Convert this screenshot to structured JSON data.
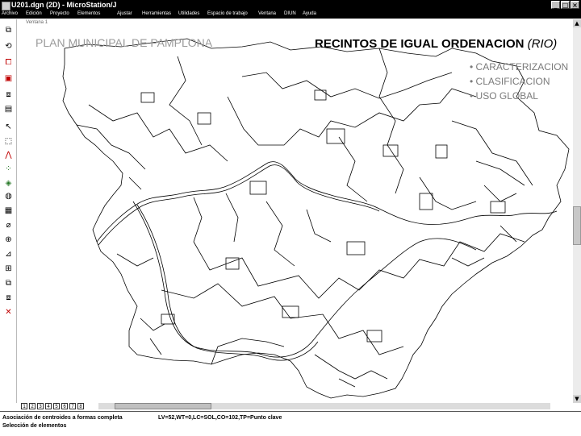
{
  "window": {
    "title": "U201.dgn (2D) - MicroStation/J"
  },
  "menu": [
    "Archivo",
    "Edición",
    "Proyecto",
    "Elementos",
    "Ajustar",
    "Herramientas",
    "Utilidades",
    "Espacio de trabajo",
    "Ventana",
    "DIUN",
    "Ayuda"
  ],
  "view_window": {
    "title": "Ventana 1"
  },
  "overlay": {
    "left_title": "PLAN MUNICIPAL DE PAMPLONA",
    "main_title": "RECINTOS DE IGUAL ORDENACION",
    "main_title_suffix": "(RIO)",
    "bullets": [
      "• CARACTERIZACION",
      "• CLASIFICACION",
      "• USO GLOBAL"
    ]
  },
  "view_buttons": [
    "1",
    "2",
    "3",
    "4",
    "5",
    "6",
    "7",
    "8"
  ],
  "status": {
    "left_line1": "Asociación de centroides a formas completa",
    "left_line2": "Selección de elementos",
    "right_line1": "LV=52,WT=0,LC=SOL,CO=102,TP=Punto clave"
  },
  "icons": [
    "window-minimize-icon",
    "window-maximize-icon",
    "window-close-icon",
    "element-select-icon",
    "fence-icon",
    "line-icon",
    "circle-icon",
    "fill-icon",
    "measure-icon",
    "zoom-icon",
    "delete-icon"
  ]
}
